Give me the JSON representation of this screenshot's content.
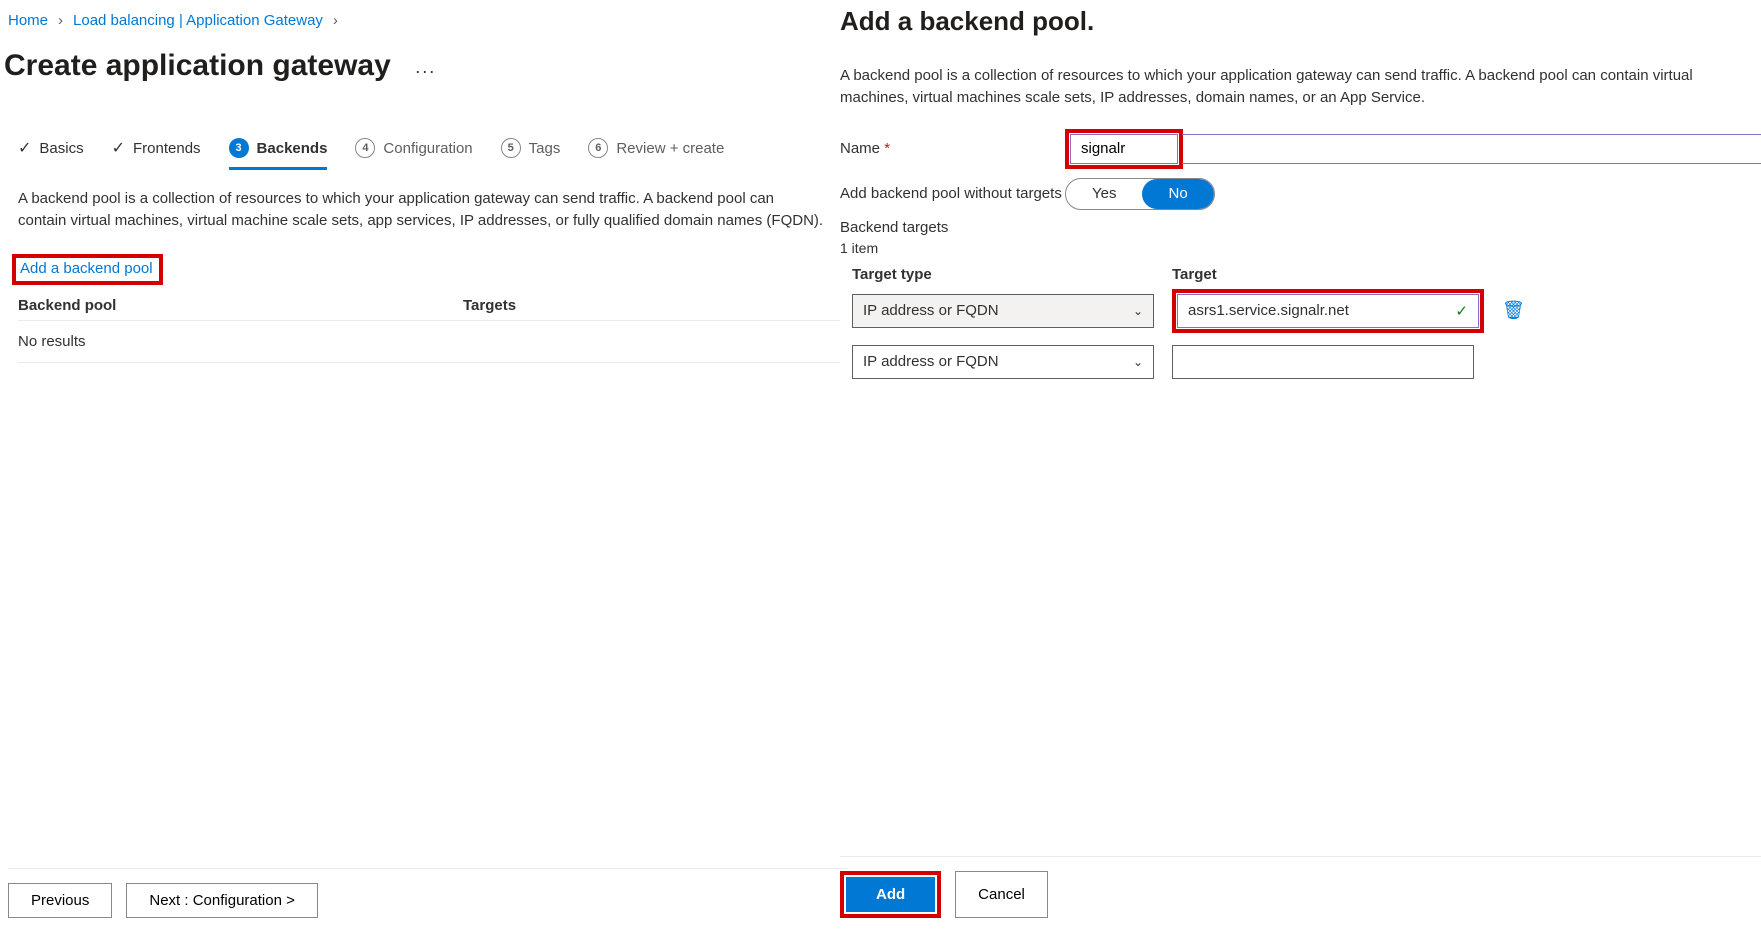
{
  "breadcrumb": {
    "home": "Home",
    "lb": "Load balancing | Application Gateway"
  },
  "page_title": "Create application gateway",
  "steps": {
    "basics": "Basics",
    "frontends": "Frontends",
    "backends": "Backends",
    "configuration_num": "4",
    "configuration": "Configuration",
    "tags_num": "5",
    "tags": "Tags",
    "review_num": "6",
    "review": "Review + create"
  },
  "intro": "A backend pool is a collection of resources to which your application gateway can send traffic. A backend pool can contain virtual machines, virtual machine scale sets, app services, IP addresses, or fully qualified domain names (FQDN).",
  "add_pool_link": "Add a backend pool",
  "table": {
    "col_pool": "Backend pool",
    "col_targets": "Targets",
    "no_results": "No results"
  },
  "footer": {
    "previous": "Previous",
    "next": "Next : Configuration >"
  },
  "side": {
    "title": "Add a backend pool.",
    "desc": "A backend pool is a collection of resources to which your application gateway can send traffic. A backend pool can contain virtual machines, virtual machines scale sets, IP addresses, domain names, or an App Service.",
    "name_label": "Name",
    "name_value": "signalr",
    "without_targets_label": "Add backend pool without targets",
    "yes": "Yes",
    "no": "No",
    "backend_targets": "Backend targets",
    "item_count": "1 item",
    "col_type": "Target type",
    "col_target": "Target",
    "rows": [
      {
        "type": "IP address or FQDN",
        "target": "asrs1.service.signalr.net",
        "valid": true
      },
      {
        "type": "IP address or FQDN",
        "target": ""
      }
    ],
    "add": "Add",
    "cancel": "Cancel"
  }
}
